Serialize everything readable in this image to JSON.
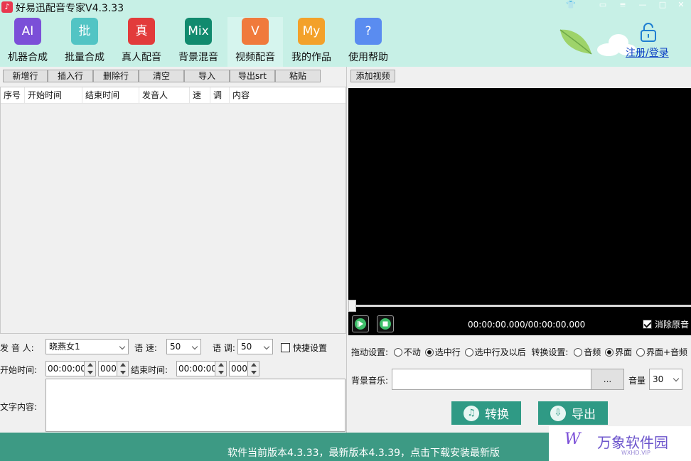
{
  "window": {
    "title": "好易迅配音专家V4.3.33",
    "controls": [
      "shirt-icon",
      "message-icon",
      "menu-icon",
      "minimize-icon",
      "maximize-icon",
      "close-icon"
    ]
  },
  "nav": {
    "items": [
      {
        "tile": "AI",
        "label": "机器合成",
        "color": "#7b4fd8"
      },
      {
        "tile": "批",
        "label": "批量合成",
        "color": "#52c4c4"
      },
      {
        "tile": "真",
        "label": "真人配音",
        "color": "#e23b3b"
      },
      {
        "tile": "Mix",
        "label": "背景混音",
        "color": "#118a6e"
      },
      {
        "tile": "V",
        "label": "视频配音",
        "color": "#f07a3c"
      },
      {
        "tile": "My",
        "label": "我的作品",
        "color": "#f3a12a"
      },
      {
        "tile": "?",
        "label": "使用帮助",
        "color": "#5a8cf0"
      }
    ],
    "active_index": 4,
    "login_label": "注册/登录"
  },
  "toolbar": {
    "buttons": [
      "新增行",
      "插入行",
      "删除行",
      "清空",
      "导入",
      "导出srt",
      "粘贴"
    ],
    "add_video": "添加视频"
  },
  "table": {
    "columns": [
      "序号",
      "开始时间",
      "结束时间",
      "发音人",
      "速",
      "调",
      "内容"
    ]
  },
  "player": {
    "timecode": "00:00:00.000/00:00:00.000",
    "mute_label": "消除原音",
    "mute_checked": true
  },
  "form": {
    "voice_label": "发 音 人:",
    "voice_value": "晓燕女1",
    "speed_label": "语 速:",
    "speed_value": "50",
    "pitch_label": "语 调:",
    "pitch_value": "50",
    "quick_label": "快捷设置",
    "start_label": "开始时间:",
    "start_time": "00:00:00",
    "start_ms": "000",
    "end_label": "结束时间:",
    "end_time": "00:00:00",
    "end_ms": "000",
    "content_label": "文字内容:"
  },
  "settings": {
    "drag_label": "拖动设置:",
    "drag_options": [
      "不动",
      "选中行",
      "选中行及以后"
    ],
    "drag_selected": 1,
    "convert_label": "转换设置:",
    "convert_options": [
      "音频",
      "界面",
      "界面+音频"
    ],
    "convert_selected": 1,
    "bgm_label": "背景音乐:",
    "browse_label": "...",
    "volume_label": "音量",
    "volume_value": "30",
    "convert_button": "转换",
    "export_button": "导出"
  },
  "status": {
    "text": "软件当前版本4.3.33，最新版本4.3.39，点击下载安装最新版"
  },
  "watermark": {
    "logo": "W",
    "text": "万象软件园",
    "sub": "WXHD.VIP"
  }
}
